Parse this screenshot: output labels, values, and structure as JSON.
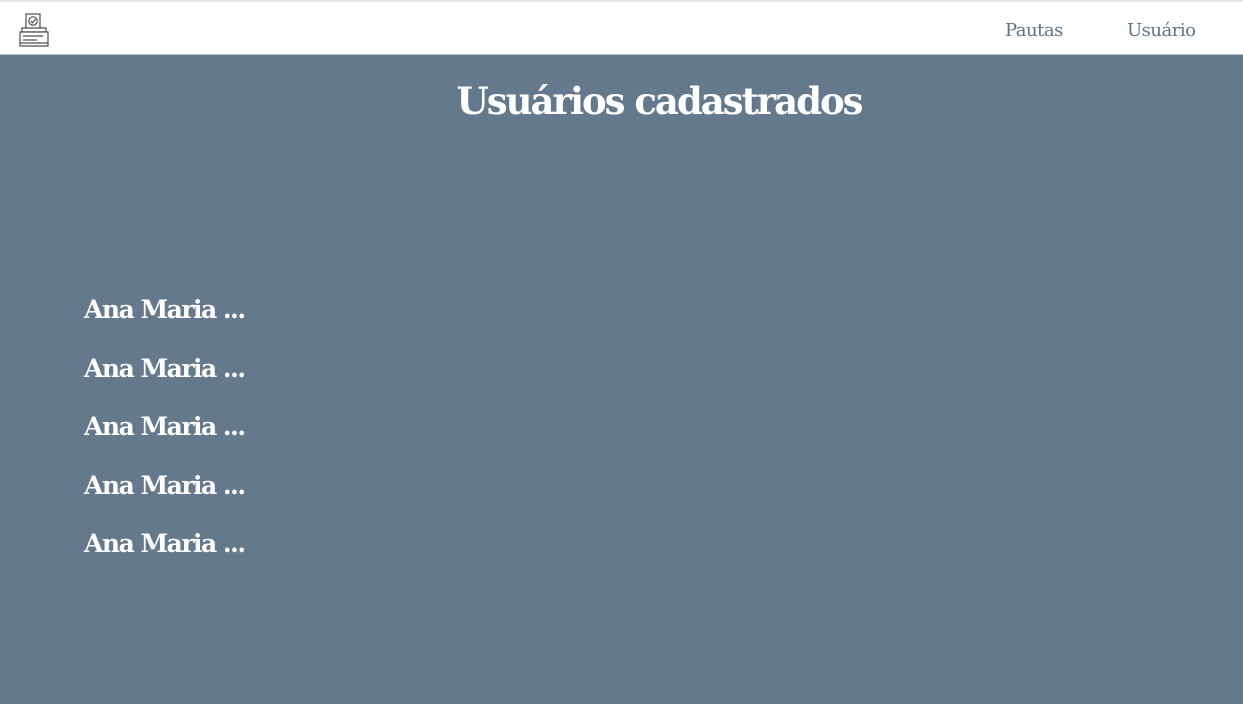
{
  "header": {
    "logo_icon": "ballot-box-icon",
    "nav": [
      {
        "label": "Pautas"
      },
      {
        "label": "Usuário"
      }
    ]
  },
  "main": {
    "title": "Usuários cadastrados",
    "users": [
      {
        "name": "Ana Maria ..."
      },
      {
        "name": "Ana Maria ..."
      },
      {
        "name": "Ana Maria ..."
      },
      {
        "name": "Ana Maria ..."
      },
      {
        "name": "Ana Maria ..."
      }
    ]
  },
  "colors": {
    "background": "#64798c",
    "header_bg": "#ffffff",
    "nav_text": "#5f7386",
    "content_text": "#ffffff"
  }
}
